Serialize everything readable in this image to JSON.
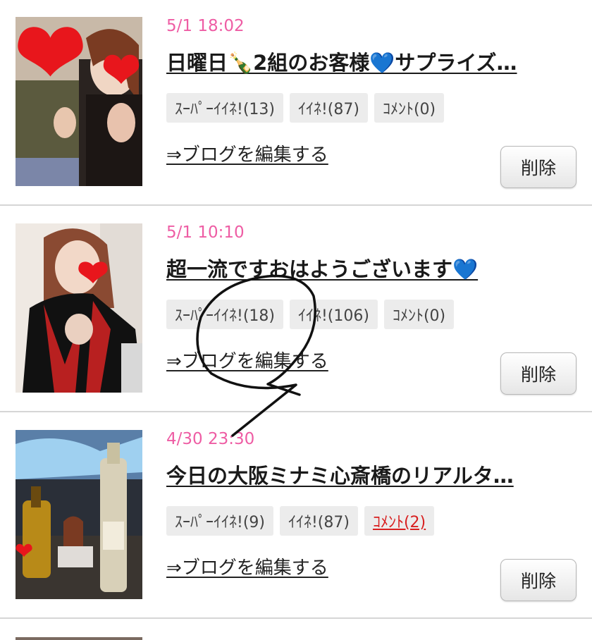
{
  "posts": [
    {
      "date": "5/1 18:02",
      "title": "日曜日🍾2組のお客様💙サプライズ…",
      "tags": [
        "ｽｰﾊﾟｰｲｲﾈ!(13)",
        "ｲｲﾈ!(87)",
        "ｺﾒﾝﾄ(0)"
      ],
      "edit_label": "⇒ブログを編集する",
      "delete_label": "削除"
    },
    {
      "date": "5/1 10:10",
      "title": "超一流ですおはようございます💙",
      "tags": [
        "ｽｰﾊﾟｰｲｲﾈ!(18)",
        "ｲｲﾈ!(106)",
        "ｺﾒﾝﾄ(0)"
      ],
      "edit_label": "⇒ブログを編集する",
      "delete_label": "削除"
    },
    {
      "date": "4/30 23:30",
      "title": "今日の大阪ミナミ心斎橋のリアルタ…",
      "tags": [
        "ｽｰﾊﾟｰｲｲﾈ!(9)",
        "ｲｲﾈ!(87)",
        "ｺﾒﾝﾄ(2)"
      ],
      "edit_label": "⇒ブログを編集する",
      "delete_label": "削除"
    }
  ],
  "colors": {
    "date": "#ee5da4",
    "comment_highlight": "#d82020",
    "tag_bg": "#ececec",
    "divider": "#d6d6d6"
  },
  "annotation": "hand-drawn-circle-mark"
}
